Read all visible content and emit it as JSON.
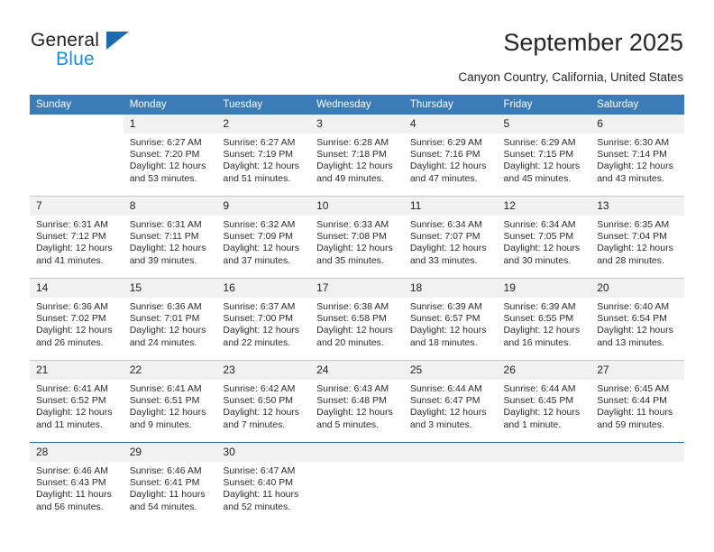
{
  "brand": {
    "name_top": "General",
    "name_bottom": "Blue",
    "color_dark": "#231f20",
    "color_blue": "#1a8fe0",
    "triangle_color": "#1a6bb0"
  },
  "header": {
    "title": "September 2025",
    "subtitle": "Canyon Country, California, United States"
  },
  "theme": {
    "header_bg": "#3b7cb8",
    "daynum_bg": "#f1f1f1",
    "grid_line": "#c8c8c8",
    "accent_line": "#2b6ca8"
  },
  "calendar": {
    "weekday_headers": [
      "Sunday",
      "Monday",
      "Tuesday",
      "Wednesday",
      "Thursday",
      "Friday",
      "Saturday"
    ],
    "weeks": [
      [
        {
          "day": "",
          "sunrise": "",
          "sunset": "",
          "daylight_line1": "",
          "daylight_line2": "",
          "blank": true
        },
        {
          "day": "1",
          "sunrise": "Sunrise: 6:27 AM",
          "sunset": "Sunset: 7:20 PM",
          "daylight_line1": "Daylight: 12 hours",
          "daylight_line2": "and 53 minutes."
        },
        {
          "day": "2",
          "sunrise": "Sunrise: 6:27 AM",
          "sunset": "Sunset: 7:19 PM",
          "daylight_line1": "Daylight: 12 hours",
          "daylight_line2": "and 51 minutes."
        },
        {
          "day": "3",
          "sunrise": "Sunrise: 6:28 AM",
          "sunset": "Sunset: 7:18 PM",
          "daylight_line1": "Daylight: 12 hours",
          "daylight_line2": "and 49 minutes."
        },
        {
          "day": "4",
          "sunrise": "Sunrise: 6:29 AM",
          "sunset": "Sunset: 7:16 PM",
          "daylight_line1": "Daylight: 12 hours",
          "daylight_line2": "and 47 minutes."
        },
        {
          "day": "5",
          "sunrise": "Sunrise: 6:29 AM",
          "sunset": "Sunset: 7:15 PM",
          "daylight_line1": "Daylight: 12 hours",
          "daylight_line2": "and 45 minutes."
        },
        {
          "day": "6",
          "sunrise": "Sunrise: 6:30 AM",
          "sunset": "Sunset: 7:14 PM",
          "daylight_line1": "Daylight: 12 hours",
          "daylight_line2": "and 43 minutes."
        }
      ],
      [
        {
          "day": "7",
          "sunrise": "Sunrise: 6:31 AM",
          "sunset": "Sunset: 7:12 PM",
          "daylight_line1": "Daylight: 12 hours",
          "daylight_line2": "and 41 minutes."
        },
        {
          "day": "8",
          "sunrise": "Sunrise: 6:31 AM",
          "sunset": "Sunset: 7:11 PM",
          "daylight_line1": "Daylight: 12 hours",
          "daylight_line2": "and 39 minutes."
        },
        {
          "day": "9",
          "sunrise": "Sunrise: 6:32 AM",
          "sunset": "Sunset: 7:09 PM",
          "daylight_line1": "Daylight: 12 hours",
          "daylight_line2": "and 37 minutes."
        },
        {
          "day": "10",
          "sunrise": "Sunrise: 6:33 AM",
          "sunset": "Sunset: 7:08 PM",
          "daylight_line1": "Daylight: 12 hours",
          "daylight_line2": "and 35 minutes."
        },
        {
          "day": "11",
          "sunrise": "Sunrise: 6:34 AM",
          "sunset": "Sunset: 7:07 PM",
          "daylight_line1": "Daylight: 12 hours",
          "daylight_line2": "and 33 minutes."
        },
        {
          "day": "12",
          "sunrise": "Sunrise: 6:34 AM",
          "sunset": "Sunset: 7:05 PM",
          "daylight_line1": "Daylight: 12 hours",
          "daylight_line2": "and 30 minutes."
        },
        {
          "day": "13",
          "sunrise": "Sunrise: 6:35 AM",
          "sunset": "Sunset: 7:04 PM",
          "daylight_line1": "Daylight: 12 hours",
          "daylight_line2": "and 28 minutes."
        }
      ],
      [
        {
          "day": "14",
          "sunrise": "Sunrise: 6:36 AM",
          "sunset": "Sunset: 7:02 PM",
          "daylight_line1": "Daylight: 12 hours",
          "daylight_line2": "and 26 minutes."
        },
        {
          "day": "15",
          "sunrise": "Sunrise: 6:36 AM",
          "sunset": "Sunset: 7:01 PM",
          "daylight_line1": "Daylight: 12 hours",
          "daylight_line2": "and 24 minutes."
        },
        {
          "day": "16",
          "sunrise": "Sunrise: 6:37 AM",
          "sunset": "Sunset: 7:00 PM",
          "daylight_line1": "Daylight: 12 hours",
          "daylight_line2": "and 22 minutes."
        },
        {
          "day": "17",
          "sunrise": "Sunrise: 6:38 AM",
          "sunset": "Sunset: 6:58 PM",
          "daylight_line1": "Daylight: 12 hours",
          "daylight_line2": "and 20 minutes."
        },
        {
          "day": "18",
          "sunrise": "Sunrise: 6:39 AM",
          "sunset": "Sunset: 6:57 PM",
          "daylight_line1": "Daylight: 12 hours",
          "daylight_line2": "and 18 minutes."
        },
        {
          "day": "19",
          "sunrise": "Sunrise: 6:39 AM",
          "sunset": "Sunset: 6:55 PM",
          "daylight_line1": "Daylight: 12 hours",
          "daylight_line2": "and 16 minutes."
        },
        {
          "day": "20",
          "sunrise": "Sunrise: 6:40 AM",
          "sunset": "Sunset: 6:54 PM",
          "daylight_line1": "Daylight: 12 hours",
          "daylight_line2": "and 13 minutes."
        }
      ],
      [
        {
          "day": "21",
          "sunrise": "Sunrise: 6:41 AM",
          "sunset": "Sunset: 6:52 PM",
          "daylight_line1": "Daylight: 12 hours",
          "daylight_line2": "and 11 minutes."
        },
        {
          "day": "22",
          "sunrise": "Sunrise: 6:41 AM",
          "sunset": "Sunset: 6:51 PM",
          "daylight_line1": "Daylight: 12 hours",
          "daylight_line2": "and 9 minutes."
        },
        {
          "day": "23",
          "sunrise": "Sunrise: 6:42 AM",
          "sunset": "Sunset: 6:50 PM",
          "daylight_line1": "Daylight: 12 hours",
          "daylight_line2": "and 7 minutes."
        },
        {
          "day": "24",
          "sunrise": "Sunrise: 6:43 AM",
          "sunset": "Sunset: 6:48 PM",
          "daylight_line1": "Daylight: 12 hours",
          "daylight_line2": "and 5 minutes."
        },
        {
          "day": "25",
          "sunrise": "Sunrise: 6:44 AM",
          "sunset": "Sunset: 6:47 PM",
          "daylight_line1": "Daylight: 12 hours",
          "daylight_line2": "and 3 minutes."
        },
        {
          "day": "26",
          "sunrise": "Sunrise: 6:44 AM",
          "sunset": "Sunset: 6:45 PM",
          "daylight_line1": "Daylight: 12 hours",
          "daylight_line2": "and 1 minute."
        },
        {
          "day": "27",
          "sunrise": "Sunrise: 6:45 AM",
          "sunset": "Sunset: 6:44 PM",
          "daylight_line1": "Daylight: 11 hours",
          "daylight_line2": "and 59 minutes."
        }
      ],
      [
        {
          "day": "28",
          "sunrise": "Sunrise: 6:46 AM",
          "sunset": "Sunset: 6:43 PM",
          "daylight_line1": "Daylight: 11 hours",
          "daylight_line2": "and 56 minutes."
        },
        {
          "day": "29",
          "sunrise": "Sunrise: 6:46 AM",
          "sunset": "Sunset: 6:41 PM",
          "daylight_line1": "Daylight: 11 hours",
          "daylight_line2": "and 54 minutes."
        },
        {
          "day": "30",
          "sunrise": "Sunrise: 6:47 AM",
          "sunset": "Sunset: 6:40 PM",
          "daylight_line1": "Daylight: 11 hours",
          "daylight_line2": "and 52 minutes."
        },
        {
          "day": "",
          "sunrise": "",
          "sunset": "",
          "daylight_line1": "",
          "daylight_line2": "",
          "empty": true
        },
        {
          "day": "",
          "sunrise": "",
          "sunset": "",
          "daylight_line1": "",
          "daylight_line2": "",
          "empty": true
        },
        {
          "day": "",
          "sunrise": "",
          "sunset": "",
          "daylight_line1": "",
          "daylight_line2": "",
          "empty": true
        },
        {
          "day": "",
          "sunrise": "",
          "sunset": "",
          "daylight_line1": "",
          "daylight_line2": "",
          "empty": true
        }
      ]
    ]
  }
}
